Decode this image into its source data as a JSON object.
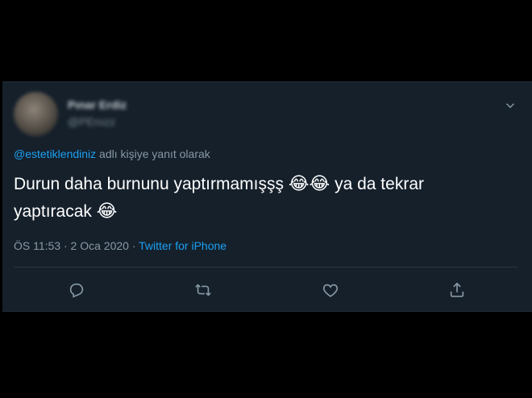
{
  "tweet": {
    "author": {
      "display_name": "Pınar Erdiz",
      "handle": "@PErozz"
    },
    "reply_context": {
      "mention": "@estetiklendiniz",
      "suffix": " adlı kişiye yanıt olarak"
    },
    "text_lines": [
      {
        "text": "Durun daha burnunu yaptırmamışşş ",
        "emoji": "😂😂",
        "after": " ya da tekrar"
      },
      {
        "text": "yaptıracak ",
        "emoji": "😂",
        "after": ""
      }
    ],
    "timestamp": "ÖS 11:53 · 2 Oca 2020 · ",
    "source": "Twitter for iPhone",
    "actions": {
      "reply_icon": "reply-icon",
      "retweet_icon": "retweet-icon",
      "like_icon": "heart-icon",
      "share_icon": "share-icon"
    },
    "colors": {
      "background": "#15202b",
      "accent": "#1da1f2",
      "muted": "#8899a6",
      "icon": "#8899a6"
    }
  }
}
